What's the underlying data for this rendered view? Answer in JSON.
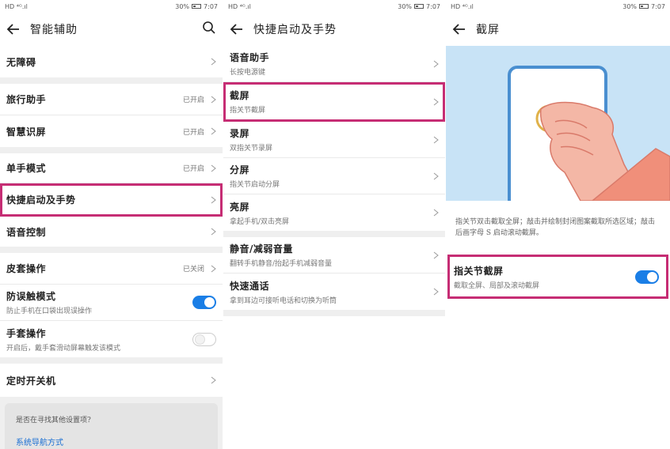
{
  "status": {
    "left": "HD ⁴ᴳ.ıl",
    "battery": "30%",
    "time": "7:07"
  },
  "panel1": {
    "title": "智能辅助",
    "rows": {
      "accessibility": "无障碍",
      "travel": {
        "label": "旅行助手",
        "value": "已开启"
      },
      "smart_screen": {
        "label": "智慧识屏",
        "value": "已开启"
      },
      "one_hand": {
        "label": "单手模式",
        "value": "已开启"
      },
      "quick_launch": "快捷启动及手势",
      "voice": "语音控制",
      "cover": {
        "label": "皮套操作",
        "value": "已关闭"
      },
      "anti_touch": {
        "label": "防误触模式",
        "sub": "防止手机在口袋出现误操作"
      },
      "glove": {
        "label": "手套操作",
        "sub": "开启后，戴手套滑动屏幕触发该模式"
      },
      "timer": "定时开关机"
    },
    "card": {
      "question": "是否在寻找其他设置项?",
      "link": "系统导航方式"
    }
  },
  "panel2": {
    "title": "快捷启动及手势",
    "rows": [
      {
        "label": "语音助手",
        "sub": "长按电源键"
      },
      {
        "label": "截屏",
        "sub": "指关节截屏"
      },
      {
        "label": "录屏",
        "sub": "双指关节录屏"
      },
      {
        "label": "分屏",
        "sub": "指关节启动分屏"
      },
      {
        "label": "亮屏",
        "sub": "拿起手机/双击亮屏"
      },
      {
        "label": "静音/减弱音量",
        "sub": "翻转手机静音/抬起手机减弱音量"
      },
      {
        "label": "快速通话",
        "sub": "拿到耳边可接听电话和切换为听筒"
      }
    ]
  },
  "panel3": {
    "title": "截屏",
    "description": "指关节双击截取全屏；敲击并绘制封闭图案截取所选区域；敲击后画字母 S 启动滚动截屏。",
    "toggle_row": {
      "label": "指关节截屏",
      "sub": "截取全屏、局部及滚动截屏"
    }
  },
  "colors": {
    "accent": "#1a7ee6",
    "highlight": "#c62d74",
    "illustration_bg": "#c8e3f6"
  }
}
